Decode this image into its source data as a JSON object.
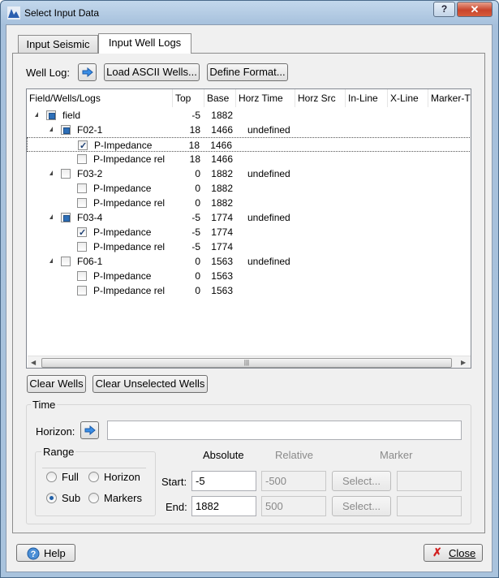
{
  "window": {
    "title": "Select Input Data",
    "help_glyph": "?",
    "close_glyph": "✕"
  },
  "tabs": [
    {
      "label": "Input Seismic",
      "active": false
    },
    {
      "label": "Input Well Logs",
      "active": true
    }
  ],
  "well_log_bar": {
    "label": "Well Log:",
    "load_ascii": "Load ASCII Wells...",
    "define_format": "Define Format..."
  },
  "tree": {
    "columns": [
      "Field/Wells/Logs",
      "Top",
      "Base",
      "Horz Time",
      "Horz Src",
      "In-Line",
      "X-Line",
      "Marker-T"
    ],
    "rows": [
      {
        "label": "field",
        "top": "-5",
        "base": "1882",
        "horz_time": "",
        "check": "partial",
        "level": 0,
        "expander": true,
        "selected": false
      },
      {
        "label": "F02-1",
        "top": "18",
        "base": "1466",
        "horz_time": "undefined",
        "check": "partial",
        "level": 1,
        "expander": true,
        "selected": false
      },
      {
        "label": "P-Impedance",
        "top": "18",
        "base": "1466",
        "horz_time": "",
        "check": "checked",
        "level": 2,
        "expander": false,
        "selected": true
      },
      {
        "label": "P-Impedance rel",
        "top": "18",
        "base": "1466",
        "horz_time": "",
        "check": "unchecked",
        "level": 2,
        "expander": false,
        "selected": false
      },
      {
        "label": "F03-2",
        "top": "0",
        "base": "1882",
        "horz_time": "undefined",
        "check": "unchecked",
        "level": 1,
        "expander": true,
        "selected": false
      },
      {
        "label": "P-Impedance",
        "top": "0",
        "base": "1882",
        "horz_time": "",
        "check": "unchecked",
        "level": 2,
        "expander": false,
        "selected": false
      },
      {
        "label": "P-Impedance rel",
        "top": "0",
        "base": "1882",
        "horz_time": "",
        "check": "unchecked",
        "level": 2,
        "expander": false,
        "selected": false
      },
      {
        "label": "F03-4",
        "top": "-5",
        "base": "1774",
        "horz_time": "undefined",
        "check": "partial",
        "level": 1,
        "expander": true,
        "selected": false
      },
      {
        "label": "P-Impedance",
        "top": "-5",
        "base": "1774",
        "horz_time": "",
        "check": "checked",
        "level": 2,
        "expander": false,
        "selected": false
      },
      {
        "label": "P-Impedance rel",
        "top": "-5",
        "base": "1774",
        "horz_time": "",
        "check": "unchecked",
        "level": 2,
        "expander": false,
        "selected": false
      },
      {
        "label": "F06-1",
        "top": "0",
        "base": "1563",
        "horz_time": "undefined",
        "check": "unchecked",
        "level": 1,
        "expander": true,
        "selected": false
      },
      {
        "label": "P-Impedance",
        "top": "0",
        "base": "1563",
        "horz_time": "",
        "check": "unchecked",
        "level": 2,
        "expander": false,
        "selected": false
      },
      {
        "label": "P-Impedance rel",
        "top": "0",
        "base": "1563",
        "horz_time": "",
        "check": "unchecked",
        "level": 2,
        "expander": false,
        "selected": false
      }
    ],
    "scroll_thumb_glyph": "|||"
  },
  "actions": {
    "clear_wells": "Clear Wells",
    "clear_unselected": "Clear Unselected Wells"
  },
  "time": {
    "legend": "Time",
    "horizon_label": "Horizon:",
    "horizon_value": "",
    "range": {
      "legend": "Range",
      "full": "Full",
      "horizon": "Horizon",
      "sub": "Sub",
      "markers": "Markers",
      "selected": "Sub"
    },
    "headers": {
      "absolute": "Absolute",
      "relative": "Relative",
      "marker": "Marker"
    },
    "start_label": "Start:",
    "end_label": "End:",
    "start_abs": "-5",
    "end_abs": "1882",
    "start_rel": "-500",
    "end_rel": "500",
    "select_label": "Select..."
  },
  "footer": {
    "help": "Help",
    "close": "Close"
  },
  "colors": {
    "accent": "#2d6fb8",
    "close_icon": "#d22020"
  }
}
